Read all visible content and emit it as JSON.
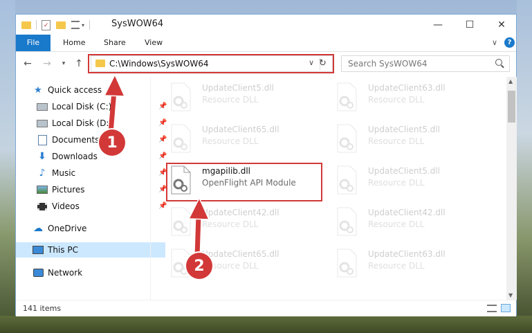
{
  "window": {
    "title": "SysWOW64",
    "minimize": "—",
    "maximize": "☐",
    "close": "✕"
  },
  "ribbon": {
    "tabs": [
      "File",
      "Home",
      "Share",
      "View"
    ],
    "expand": "∨",
    "help": "?"
  },
  "address": {
    "path": "C:\\Windows\\SysWOW64",
    "dropdown": "∨",
    "refresh": "↻"
  },
  "search": {
    "placeholder": "Search SysWOW64"
  },
  "navigation": {
    "quick_access": "Quick access",
    "items": [
      {
        "label": "Local Disk (C:)",
        "icon": "drive-icon"
      },
      {
        "label": "Local Disk (D:)",
        "icon": "drive-icon"
      },
      {
        "label": "Documents",
        "icon": "documents-icon"
      },
      {
        "label": "Downloads",
        "icon": "downloads-icon"
      },
      {
        "label": "Music",
        "icon": "music-icon"
      },
      {
        "label": "Pictures",
        "icon": "pictures-icon"
      },
      {
        "label": "Videos",
        "icon": "videos-icon"
      }
    ],
    "onedrive": "OneDrive",
    "this_pc": "This PC",
    "network": "Network"
  },
  "files": [
    {
      "name": "UpdateClient5.dll",
      "desc": "Resource DLL",
      "highlighted": false
    },
    {
      "name": "UpdateClient63.dll",
      "desc": "Resource DLL",
      "highlighted": false
    },
    {
      "name": "UpdateClient65.dll",
      "desc": "Resource DLL",
      "highlighted": false
    },
    {
      "name": "UpdateClient5.dll",
      "desc": "Resource DLL",
      "highlighted": false
    },
    {
      "name": "mgapilib.dll",
      "desc": "OpenFlight API Module",
      "highlighted": true
    },
    {
      "name": "UpdateClient5.dll",
      "desc": "Resource DLL",
      "highlighted": false
    },
    {
      "name": "UpdateClient42.dll",
      "desc": "Resource DLL",
      "highlighted": false
    },
    {
      "name": "UpdateClient42.dll",
      "desc": "Resource DLL",
      "highlighted": false
    },
    {
      "name": "UpdateClient65.dll",
      "desc": "Resource DLL",
      "highlighted": false
    },
    {
      "name": "UpdateClient63.dll",
      "desc": "Resource DLL",
      "highlighted": false
    }
  ],
  "status": {
    "item_count": "141 items"
  },
  "annotations": {
    "step1": "1",
    "step2": "2"
  },
  "colors": {
    "accent": "#1979ca",
    "highlight": "#d23838",
    "selected": "#cce8ff"
  }
}
